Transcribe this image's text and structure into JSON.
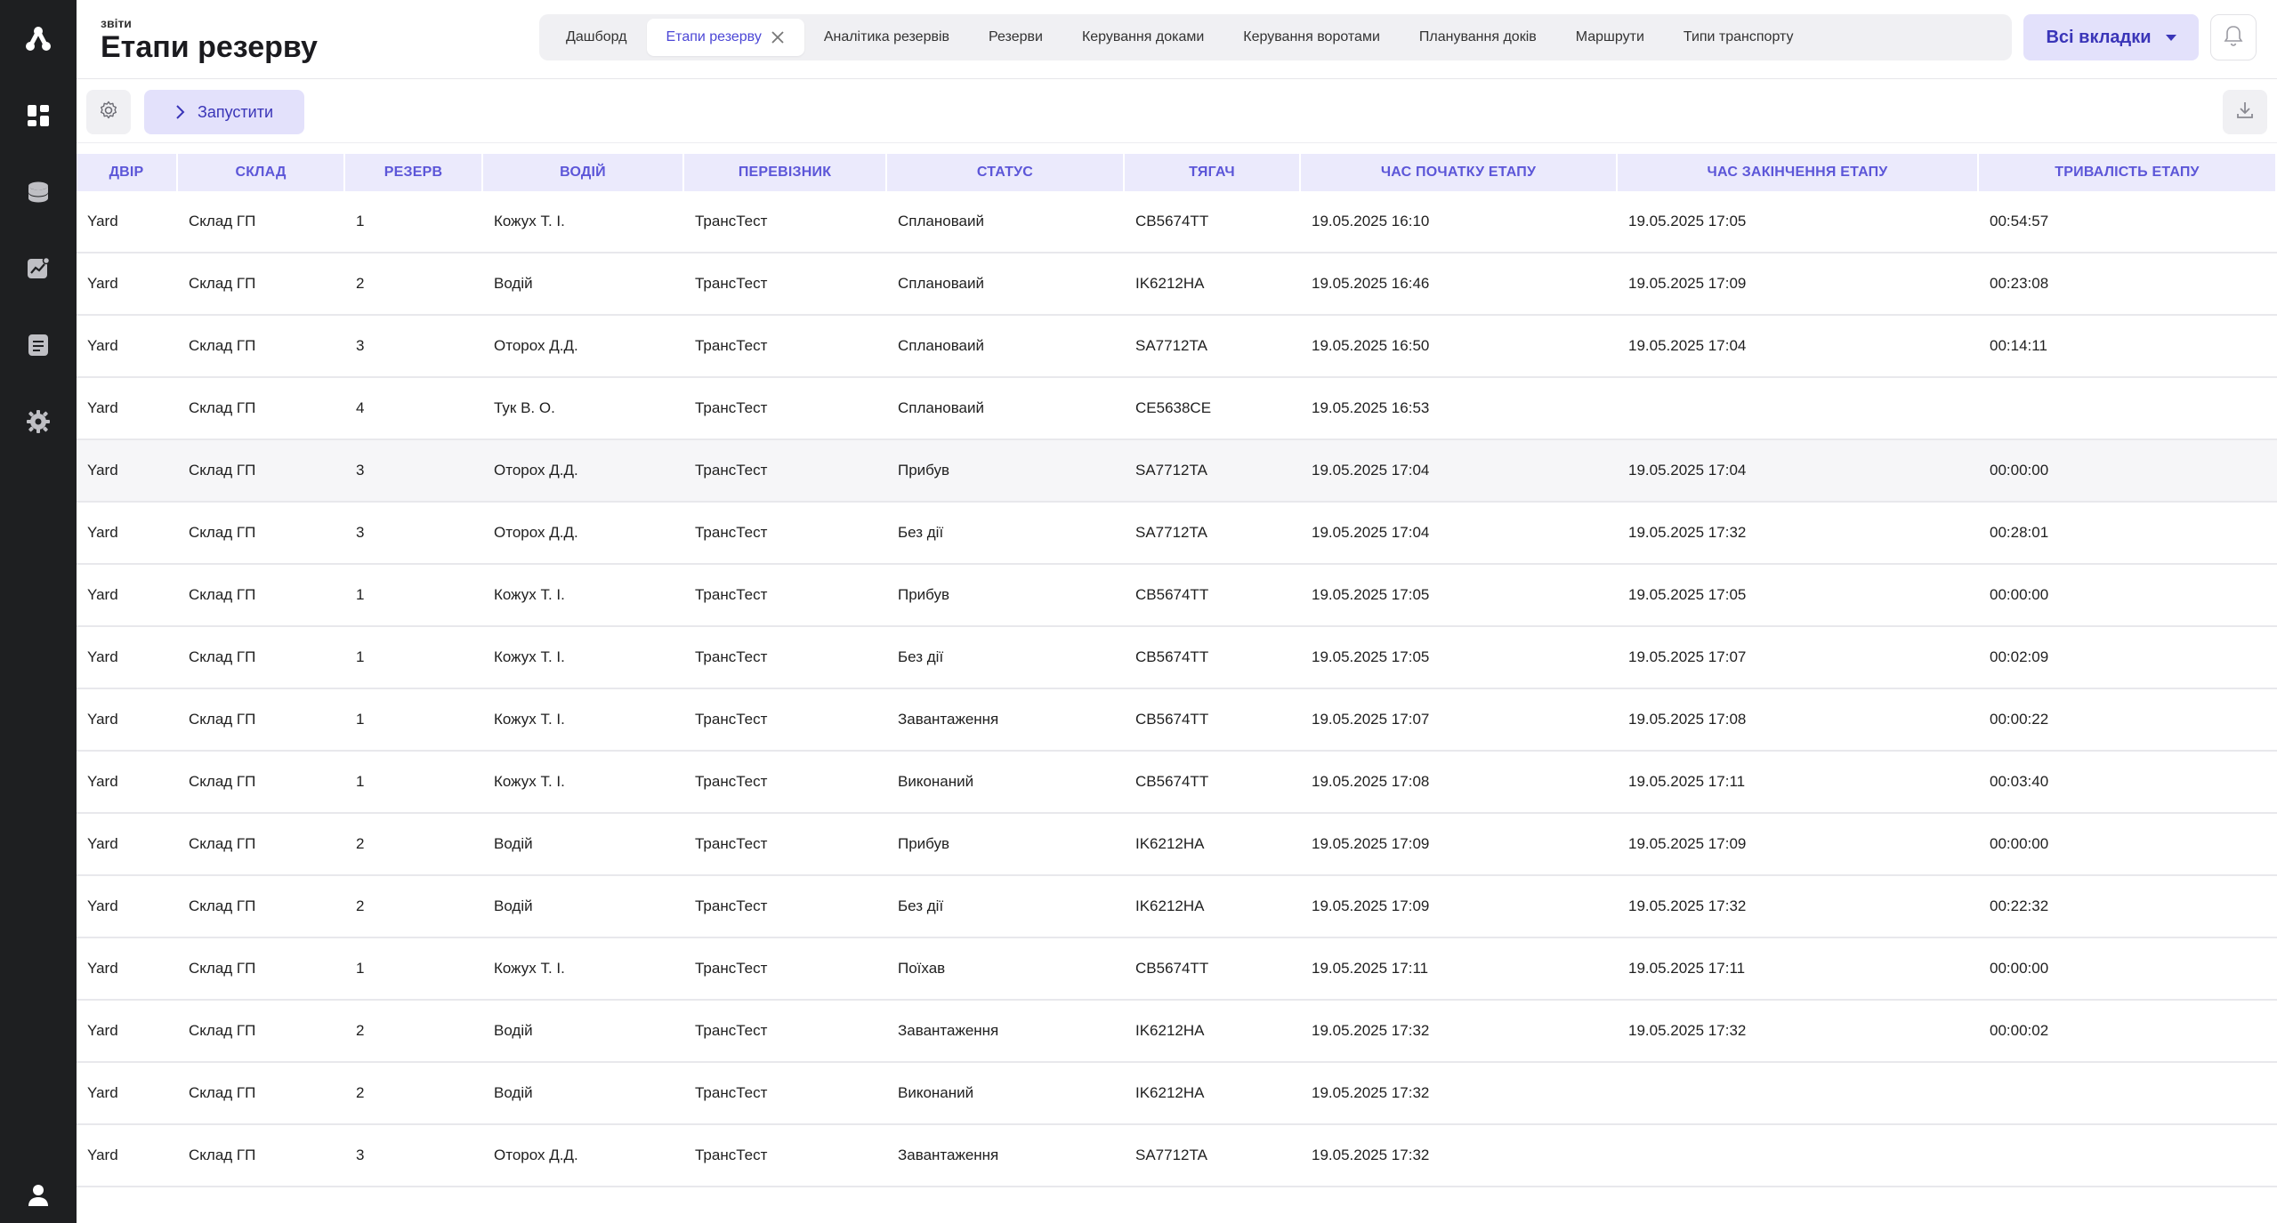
{
  "sidebar": {
    "items": [
      {
        "icon": "dashboard-icon"
      },
      {
        "icon": "database-icon"
      },
      {
        "icon": "analytics-icon"
      },
      {
        "icon": "document-icon"
      },
      {
        "icon": "settings-icon"
      }
    ]
  },
  "header": {
    "subtitle": "звіти",
    "title": "Етапи резерву",
    "tabs": [
      {
        "label": "Дашборд"
      },
      {
        "label": "Етапи резерву"
      },
      {
        "label": "Аналітика резервів"
      },
      {
        "label": "Резерви"
      },
      {
        "label": "Керування доками"
      },
      {
        "label": "Керування воротами"
      },
      {
        "label": "Планування доків"
      },
      {
        "label": "Маршрути"
      },
      {
        "label": "Типи транспорту"
      }
    ],
    "all_tabs_label": "Всі вкладки"
  },
  "toolbar": {
    "run_label": "Запустити"
  },
  "table": {
    "columns": [
      "Двір",
      "Склад",
      "Резерв",
      "Водій",
      "Перевізник",
      "Статус",
      "Тягач",
      "Час початку етапу",
      "Час закінчення етапу",
      "Тривалість етапу"
    ],
    "rows": [
      [
        "Yard",
        "Склад ГП",
        "1",
        "Кожух Т. І.",
        "ТрансТест",
        "Сплановаий",
        "CB5674TT",
        "19.05.2025 16:10",
        "19.05.2025 17:05",
        "00:54:57"
      ],
      [
        "Yard",
        "Склад ГП",
        "2",
        "Водій",
        "ТрансТест",
        "Сплановаий",
        "IK6212HA",
        "19.05.2025 16:46",
        "19.05.2025 17:09",
        "00:23:08"
      ],
      [
        "Yard",
        "Склад ГП",
        "3",
        "Оторох Д.Д.",
        "ТрансТест",
        "Сплановаий",
        "SA7712TA",
        "19.05.2025 16:50",
        "19.05.2025 17:04",
        "00:14:11"
      ],
      [
        "Yard",
        "Склад ГП",
        "4",
        "Тук В. О.",
        "ТрансТест",
        "Сплановаий",
        "CE5638CE",
        "19.05.2025 16:53",
        "",
        ""
      ],
      [
        "Yard",
        "Склад ГП",
        "3",
        "Оторох Д.Д.",
        "ТрансТест",
        "Прибув",
        "SA7712TA",
        "19.05.2025 17:04",
        "19.05.2025 17:04",
        "00:00:00"
      ],
      [
        "Yard",
        "Склад ГП",
        "3",
        "Оторох Д.Д.",
        "ТрансТест",
        "Без дії",
        "SA7712TA",
        "19.05.2025 17:04",
        "19.05.2025 17:32",
        "00:28:01"
      ],
      [
        "Yard",
        "Склад ГП",
        "1",
        "Кожух Т. І.",
        "ТрансТест",
        "Прибув",
        "CB5674TT",
        "19.05.2025 17:05",
        "19.05.2025 17:05",
        "00:00:00"
      ],
      [
        "Yard",
        "Склад ГП",
        "1",
        "Кожух Т. І.",
        "ТрансТест",
        "Без дії",
        "CB5674TT",
        "19.05.2025 17:05",
        "19.05.2025 17:07",
        "00:02:09"
      ],
      [
        "Yard",
        "Склад ГП",
        "1",
        "Кожух Т. І.",
        "ТрансТест",
        "Завантаження",
        "CB5674TT",
        "19.05.2025 17:07",
        "19.05.2025 17:08",
        "00:00:22"
      ],
      [
        "Yard",
        "Склад ГП",
        "1",
        "Кожух Т. І.",
        "ТрансТест",
        "Виконаний",
        "CB5674TT",
        "19.05.2025 17:08",
        "19.05.2025 17:11",
        "00:03:40"
      ],
      [
        "Yard",
        "Склад ГП",
        "2",
        "Водій",
        "ТрансТест",
        "Прибув",
        "IK6212HA",
        "19.05.2025 17:09",
        "19.05.2025 17:09",
        "00:00:00"
      ],
      [
        "Yard",
        "Склад ГП",
        "2",
        "Водій",
        "ТрансТест",
        "Без дії",
        "IK6212HA",
        "19.05.2025 17:09",
        "19.05.2025 17:32",
        "00:22:32"
      ],
      [
        "Yard",
        "Склад ГП",
        "1",
        "Кожух Т. І.",
        "ТрансТест",
        "Поїхав",
        "CB5674TT",
        "19.05.2025 17:11",
        "19.05.2025 17:11",
        "00:00:00"
      ],
      [
        "Yard",
        "Склад ГП",
        "2",
        "Водій",
        "ТрансТест",
        "Завантаження",
        "IK6212HA",
        "19.05.2025 17:32",
        "19.05.2025 17:32",
        "00:00:02"
      ],
      [
        "Yard",
        "Склад ГП",
        "2",
        "Водій",
        "ТрансТест",
        "Виконаний",
        "IK6212HA",
        "19.05.2025 17:32",
        "",
        ""
      ],
      [
        "Yard",
        "Склад ГП",
        "3",
        "Оторох Д.Д.",
        "ТрансТест",
        "Завантаження",
        "SA7712TA",
        "19.05.2025 17:32",
        "",
        ""
      ]
    ]
  }
}
